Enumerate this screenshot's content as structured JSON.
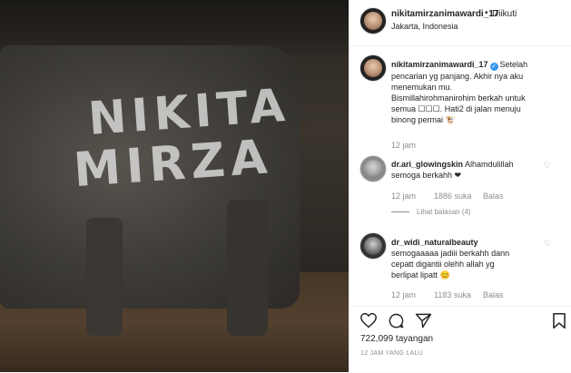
{
  "media": {
    "graffiti_line1": "NIKITA",
    "graffiti_line2": "MIRZA"
  },
  "header": {
    "username": "nikitamirzanimawardi_17",
    "dot": "•",
    "follow_label": "Diikuti",
    "location": "Jakarta, Indonesia",
    "more": "···"
  },
  "caption": {
    "username": "nikitamirzanimawardi_17",
    "verified": "✓",
    "line1": "Setelah",
    "line2": "pencarian yg panjang. Akhir nya aku",
    "line3": "menemukan mu.",
    "line4": "Bismillahirohmanirohim berkah untuk",
    "line5": "semua ☐☐☐. Hati2 di jalan menuju",
    "line6": "binong permai 🐮",
    "time": "12 jam"
  },
  "comments": [
    {
      "username": "dr.ari_glowingskin",
      "line1": "Alhamdulillah",
      "line2": "semoga berkahh ❤",
      "time": "12 jam",
      "likes": "1886 suka",
      "reply": "Balas",
      "view_replies": "Lihat balasan (4)"
    },
    {
      "username": "dr_widi_naturalbeauty",
      "line1": "semogaaaaa jadiii berkahh dann",
      "line2": "cepatt digantii olehh allah yg",
      "line3": "berlipat lipatt 😊",
      "time": "12 jam",
      "likes": "1183 suka",
      "reply": "Balas"
    }
  ],
  "stats": {
    "views": "722,099 tayangan",
    "posted": "12 JAM YANG LALU"
  }
}
